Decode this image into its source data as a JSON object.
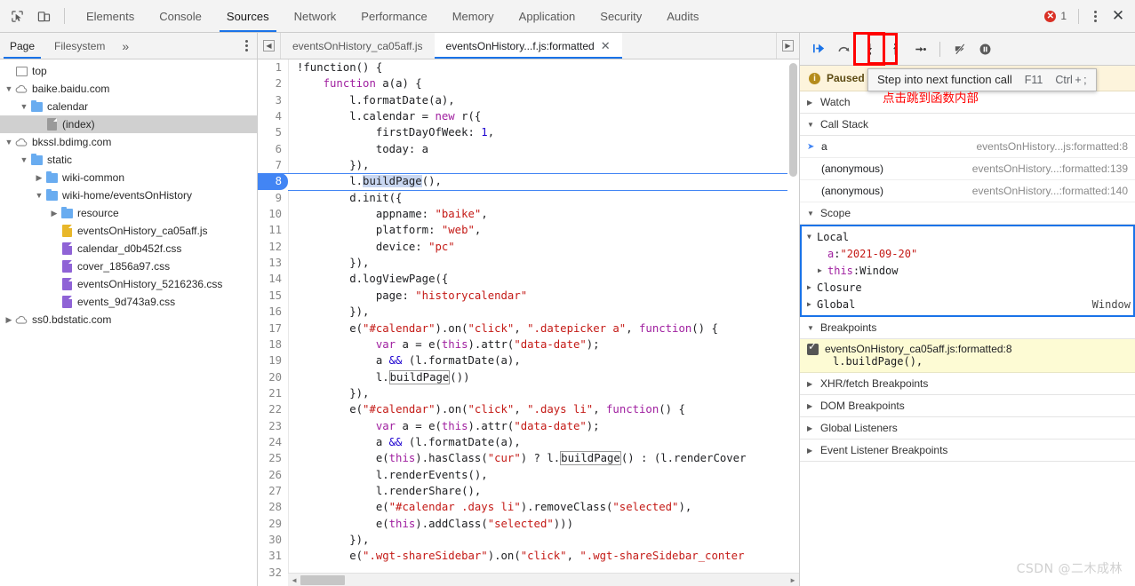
{
  "topbar": {
    "icons": [
      {
        "name": "inspect-element-icon",
        "glyph": "cursor-box"
      },
      {
        "name": "device-toolbar-icon",
        "glyph": "device"
      }
    ],
    "tabs": [
      {
        "label": "Elements",
        "active": false
      },
      {
        "label": "Console",
        "active": false
      },
      {
        "label": "Sources",
        "active": true
      },
      {
        "label": "Network",
        "active": false
      },
      {
        "label": "Performance",
        "active": false
      },
      {
        "label": "Memory",
        "active": false
      },
      {
        "label": "Application",
        "active": false
      },
      {
        "label": "Security",
        "active": false
      },
      {
        "label": "Audits",
        "active": false
      }
    ],
    "error_count": "1",
    "error_icon": "error-circle-icon",
    "more_icon": "kebab-menu-icon",
    "close_icon": "close-icon"
  },
  "navigator": {
    "tabs": [
      {
        "label": "Page",
        "active": true
      },
      {
        "label": "Filesystem",
        "active": false
      }
    ],
    "overflow_label": "»",
    "more_icon": "kebab-menu-icon",
    "tree": [
      {
        "label": "top",
        "indent": 0,
        "twisty": "",
        "icon": "frame-icon",
        "selected": false
      },
      {
        "label": "baike.baidu.com",
        "indent": 0,
        "twisty": "▼",
        "icon": "cloud-icon",
        "selected": false
      },
      {
        "label": "calendar",
        "indent": 1,
        "twisty": "▼",
        "icon": "folder-icon",
        "selected": false
      },
      {
        "label": "(index)",
        "indent": 2,
        "twisty": "",
        "icon": "document-icon",
        "selected": true
      },
      {
        "label": "bkssl.bdimg.com",
        "indent": 0,
        "twisty": "▼",
        "icon": "cloud-icon",
        "selected": false
      },
      {
        "label": "static",
        "indent": 1,
        "twisty": "▼",
        "icon": "folder-icon",
        "selected": false
      },
      {
        "label": "wiki-common",
        "indent": 2,
        "twisty": "▶",
        "icon": "folder-icon",
        "selected": false
      },
      {
        "label": "wiki-home/eventsOnHistory",
        "indent": 2,
        "twisty": "▼",
        "icon": "folder-icon",
        "selected": false
      },
      {
        "label": "resource",
        "indent": 3,
        "twisty": "▶",
        "icon": "folder-icon",
        "selected": false
      },
      {
        "label": "eventsOnHistory_ca05aff.js",
        "indent": 3,
        "twisty": "",
        "icon": "js-file-icon",
        "selected": false
      },
      {
        "label": "calendar_d0b452f.css",
        "indent": 3,
        "twisty": "",
        "icon": "css-file-icon",
        "selected": false
      },
      {
        "label": "cover_1856a97.css",
        "indent": 3,
        "twisty": "",
        "icon": "css-file-icon",
        "selected": false
      },
      {
        "label": "eventsOnHistory_5216236.css",
        "indent": 3,
        "twisty": "",
        "icon": "css-file-icon",
        "selected": false
      },
      {
        "label": "events_9d743a9.css",
        "indent": 3,
        "twisty": "",
        "icon": "css-file-icon",
        "selected": false
      },
      {
        "label": "ss0.bdstatic.com",
        "indent": 0,
        "twisty": "▶",
        "icon": "cloud-icon",
        "selected": false
      }
    ]
  },
  "editor": {
    "prev_icon": "scroll-tabs-left-icon",
    "next_icon": "scroll-tabs-right-icon",
    "tabs": [
      {
        "label": "eventsOnHistory_ca05aff.js",
        "active": false,
        "closable": false
      },
      {
        "label": "eventsOnHistory...f.js:formatted",
        "active": true,
        "closable": true,
        "close_glyph": "✕"
      }
    ],
    "breakpoint_line": 8,
    "last_line_number": "32",
    "lines": [
      {
        "n": "1",
        "tokens": [
          {
            "t": "!function() {",
            "c": "p"
          }
        ]
      },
      {
        "n": "2",
        "tokens": [
          {
            "t": "    ",
            "c": "p"
          },
          {
            "t": "function",
            "c": "k"
          },
          {
            "t": " a(a) {",
            "c": "p"
          }
        ]
      },
      {
        "n": "3",
        "tokens": [
          {
            "t": "        l.formatDate(a),",
            "c": "p"
          }
        ]
      },
      {
        "n": "4",
        "tokens": [
          {
            "t": "        l.calendar = ",
            "c": "p"
          },
          {
            "t": "new",
            "c": "k"
          },
          {
            "t": " r({",
            "c": "p"
          }
        ]
      },
      {
        "n": "5",
        "tokens": [
          {
            "t": "            firstDayOfWeek: ",
            "c": "p"
          },
          {
            "t": "1",
            "c": "n"
          },
          {
            "t": ",",
            "c": "p"
          }
        ]
      },
      {
        "n": "6",
        "tokens": [
          {
            "t": "            today: a",
            "c": "p"
          }
        ]
      },
      {
        "n": "7",
        "tokens": [
          {
            "t": "        }),",
            "c": "p"
          }
        ]
      },
      {
        "n": "8",
        "tokens": [
          {
            "t": "        l.",
            "c": "p"
          },
          {
            "t": "buildPage",
            "c": "hl"
          },
          {
            "t": "(),",
            "c": "p"
          }
        ]
      },
      {
        "n": "9",
        "tokens": [
          {
            "t": "        d.init({",
            "c": "p"
          }
        ]
      },
      {
        "n": "10",
        "tokens": [
          {
            "t": "            appname: ",
            "c": "p"
          },
          {
            "t": "\"baike\"",
            "c": "s"
          },
          {
            "t": ",",
            "c": "p"
          }
        ]
      },
      {
        "n": "11",
        "tokens": [
          {
            "t": "            platform: ",
            "c": "p"
          },
          {
            "t": "\"web\"",
            "c": "s"
          },
          {
            "t": ",",
            "c": "p"
          }
        ]
      },
      {
        "n": "12",
        "tokens": [
          {
            "t": "            device: ",
            "c": "p"
          },
          {
            "t": "\"pc\"",
            "c": "s"
          }
        ]
      },
      {
        "n": "13",
        "tokens": [
          {
            "t": "        }),",
            "c": "p"
          }
        ]
      },
      {
        "n": "14",
        "tokens": [
          {
            "t": "        d.logViewPage({",
            "c": "p"
          }
        ]
      },
      {
        "n": "15",
        "tokens": [
          {
            "t": "            page: ",
            "c": "p"
          },
          {
            "t": "\"historycalendar\"",
            "c": "s"
          }
        ]
      },
      {
        "n": "16",
        "tokens": [
          {
            "t": "        }),",
            "c": "p"
          }
        ]
      },
      {
        "n": "17",
        "tokens": [
          {
            "t": "        e(",
            "c": "p"
          },
          {
            "t": "\"#calendar\"",
            "c": "s"
          },
          {
            "t": ").on(",
            "c": "p"
          },
          {
            "t": "\"click\"",
            "c": "s"
          },
          {
            "t": ", ",
            "c": "p"
          },
          {
            "t": "\".datepicker a\"",
            "c": "s"
          },
          {
            "t": ", ",
            "c": "p"
          },
          {
            "t": "function",
            "c": "k"
          },
          {
            "t": "() {",
            "c": "p"
          }
        ]
      },
      {
        "n": "18",
        "tokens": [
          {
            "t": "            ",
            "c": "p"
          },
          {
            "t": "var",
            "c": "k"
          },
          {
            "t": " a = e(",
            "c": "p"
          },
          {
            "t": "this",
            "c": "k"
          },
          {
            "t": ").attr(",
            "c": "p"
          },
          {
            "t": "\"data-date\"",
            "c": "s"
          },
          {
            "t": ");",
            "c": "p"
          }
        ]
      },
      {
        "n": "19",
        "tokens": [
          {
            "t": "            a ",
            "c": "p"
          },
          {
            "t": "&&",
            "c": "n"
          },
          {
            "t": " (l.formatDate(a),",
            "c": "p"
          }
        ]
      },
      {
        "n": "20",
        "tokens": [
          {
            "t": "            l.",
            "c": "p"
          },
          {
            "t": "buildPage",
            "c": "boxed"
          },
          {
            "t": "())",
            "c": "p"
          }
        ]
      },
      {
        "n": "21",
        "tokens": [
          {
            "t": "        }),",
            "c": "p"
          }
        ]
      },
      {
        "n": "22",
        "tokens": [
          {
            "t": "        e(",
            "c": "p"
          },
          {
            "t": "\"#calendar\"",
            "c": "s"
          },
          {
            "t": ").on(",
            "c": "p"
          },
          {
            "t": "\"click\"",
            "c": "s"
          },
          {
            "t": ", ",
            "c": "p"
          },
          {
            "t": "\".days li\"",
            "c": "s"
          },
          {
            "t": ", ",
            "c": "p"
          },
          {
            "t": "function",
            "c": "k"
          },
          {
            "t": "() {",
            "c": "p"
          }
        ]
      },
      {
        "n": "23",
        "tokens": [
          {
            "t": "            ",
            "c": "p"
          },
          {
            "t": "var",
            "c": "k"
          },
          {
            "t": " a = e(",
            "c": "p"
          },
          {
            "t": "this",
            "c": "k"
          },
          {
            "t": ").attr(",
            "c": "p"
          },
          {
            "t": "\"data-date\"",
            "c": "s"
          },
          {
            "t": ");",
            "c": "p"
          }
        ]
      },
      {
        "n": "24",
        "tokens": [
          {
            "t": "            a ",
            "c": "p"
          },
          {
            "t": "&&",
            "c": "n"
          },
          {
            "t": " (l.formatDate(a),",
            "c": "p"
          }
        ]
      },
      {
        "n": "25",
        "tokens": [
          {
            "t": "            e(",
            "c": "p"
          },
          {
            "t": "this",
            "c": "k"
          },
          {
            "t": ").hasClass(",
            "c": "p"
          },
          {
            "t": "\"cur\"",
            "c": "s"
          },
          {
            "t": ") ? l.",
            "c": "p"
          },
          {
            "t": "buildPage",
            "c": "boxed"
          },
          {
            "t": "() : (l.renderCover",
            "c": "p"
          }
        ]
      },
      {
        "n": "26",
        "tokens": [
          {
            "t": "            l.renderEvents(),",
            "c": "p"
          }
        ]
      },
      {
        "n": "27",
        "tokens": [
          {
            "t": "            l.renderShare(),",
            "c": "p"
          }
        ]
      },
      {
        "n": "28",
        "tokens": [
          {
            "t": "            e(",
            "c": "p"
          },
          {
            "t": "\"#calendar .days li\"",
            "c": "s"
          },
          {
            "t": ").removeClass(",
            "c": "p"
          },
          {
            "t": "\"selected\"",
            "c": "s"
          },
          {
            "t": "),",
            "c": "p"
          }
        ]
      },
      {
        "n": "29",
        "tokens": [
          {
            "t": "            e(",
            "c": "p"
          },
          {
            "t": "this",
            "c": "k"
          },
          {
            "t": ").addClass(",
            "c": "p"
          },
          {
            "t": "\"selected\"",
            "c": "s"
          },
          {
            "t": ")))",
            "c": "p"
          }
        ]
      },
      {
        "n": "30",
        "tokens": [
          {
            "t": "        }),",
            "c": "p"
          }
        ]
      },
      {
        "n": "31",
        "tokens": [
          {
            "t": "        e(",
            "c": "p"
          },
          {
            "t": "\".wgt-shareSidebar\"",
            "c": "s"
          },
          {
            "t": ").on(",
            "c": "p"
          },
          {
            "t": "\"click\"",
            "c": "s"
          },
          {
            "t": ", ",
            "c": "p"
          },
          {
            "t": "\".wgt-shareSidebar_conter",
            "c": "s"
          }
        ]
      }
    ]
  },
  "debugger": {
    "toolbar": [
      {
        "name": "resume-script-execution-button",
        "title": "Resume"
      },
      {
        "name": "step-over-next-function-call-button",
        "title": "Step over"
      },
      {
        "name": "step-into-next-function-call-button",
        "title": "Step into",
        "highlighted": true
      },
      {
        "name": "step-out-of-current-function-button",
        "title": "Step out"
      },
      {
        "name": "step-button",
        "title": "Step"
      },
      {
        "name": "deactivate-breakpoints-button",
        "title": "Deactivate breakpoints"
      },
      {
        "name": "pause-on-exceptions-button",
        "title": "Pause on exceptions"
      }
    ],
    "tooltip": {
      "text": "Step into next function call",
      "key1": "F11",
      "key2": "Ctrl + ;"
    },
    "annotation_cn": "点击跳到函数内部",
    "paused_label": "Paused",
    "watch": {
      "label": "Watch",
      "twisty": "▶"
    },
    "call_stack": {
      "label": "Call Stack",
      "twisty": "▼",
      "frames": [
        {
          "name": "a",
          "location": "eventsOnHistory...js:formatted:8",
          "current": true
        },
        {
          "name": "(anonymous)",
          "location": "eventsOnHistory...:formatted:139",
          "current": false
        },
        {
          "name": "(anonymous)",
          "location": "eventsOnHistory...:formatted:140",
          "current": false
        }
      ]
    },
    "scope": {
      "label": "Scope",
      "twisty": "▼",
      "rows": [
        {
          "twisty": "▼",
          "key": "Local",
          "sep": "",
          "value": "",
          "right": "",
          "indent": 0,
          "keyclass": "sc-plain"
        },
        {
          "twisty": "",
          "key": "a",
          "sep": ": ",
          "value": "\"2021-09-20\"",
          "right": "",
          "indent": 1,
          "keyclass": "sc-val-key"
        },
        {
          "twisty": "▶",
          "key": "this",
          "sep": ": ",
          "value": "Window",
          "right": "",
          "indent": 1,
          "keyclass": "sc-key"
        },
        {
          "twisty": "▶",
          "key": "Closure",
          "sep": "",
          "value": "",
          "right": "",
          "indent": 0,
          "keyclass": "sc-plain"
        },
        {
          "twisty": "▶",
          "key": "Global",
          "sep": "",
          "value": "",
          "right": "Window",
          "indent": 0,
          "keyclass": "sc-plain"
        }
      ]
    },
    "breakpoints": {
      "label": "Breakpoints",
      "twisty": "▼",
      "items": [
        {
          "checked": true,
          "location": "eventsOnHistory_ca05aff.js:formatted:8",
          "snippet": "l.buildPage(),"
        }
      ]
    },
    "other_sections": [
      {
        "label": "XHR/fetch Breakpoints",
        "twisty": "▶"
      },
      {
        "label": "DOM Breakpoints",
        "twisty": "▶"
      },
      {
        "label": "Global Listeners",
        "twisty": "▶"
      },
      {
        "label": "Event Listener Breakpoints",
        "twisty": "▶"
      }
    ]
  },
  "watermark": "CSDN @二木成林"
}
